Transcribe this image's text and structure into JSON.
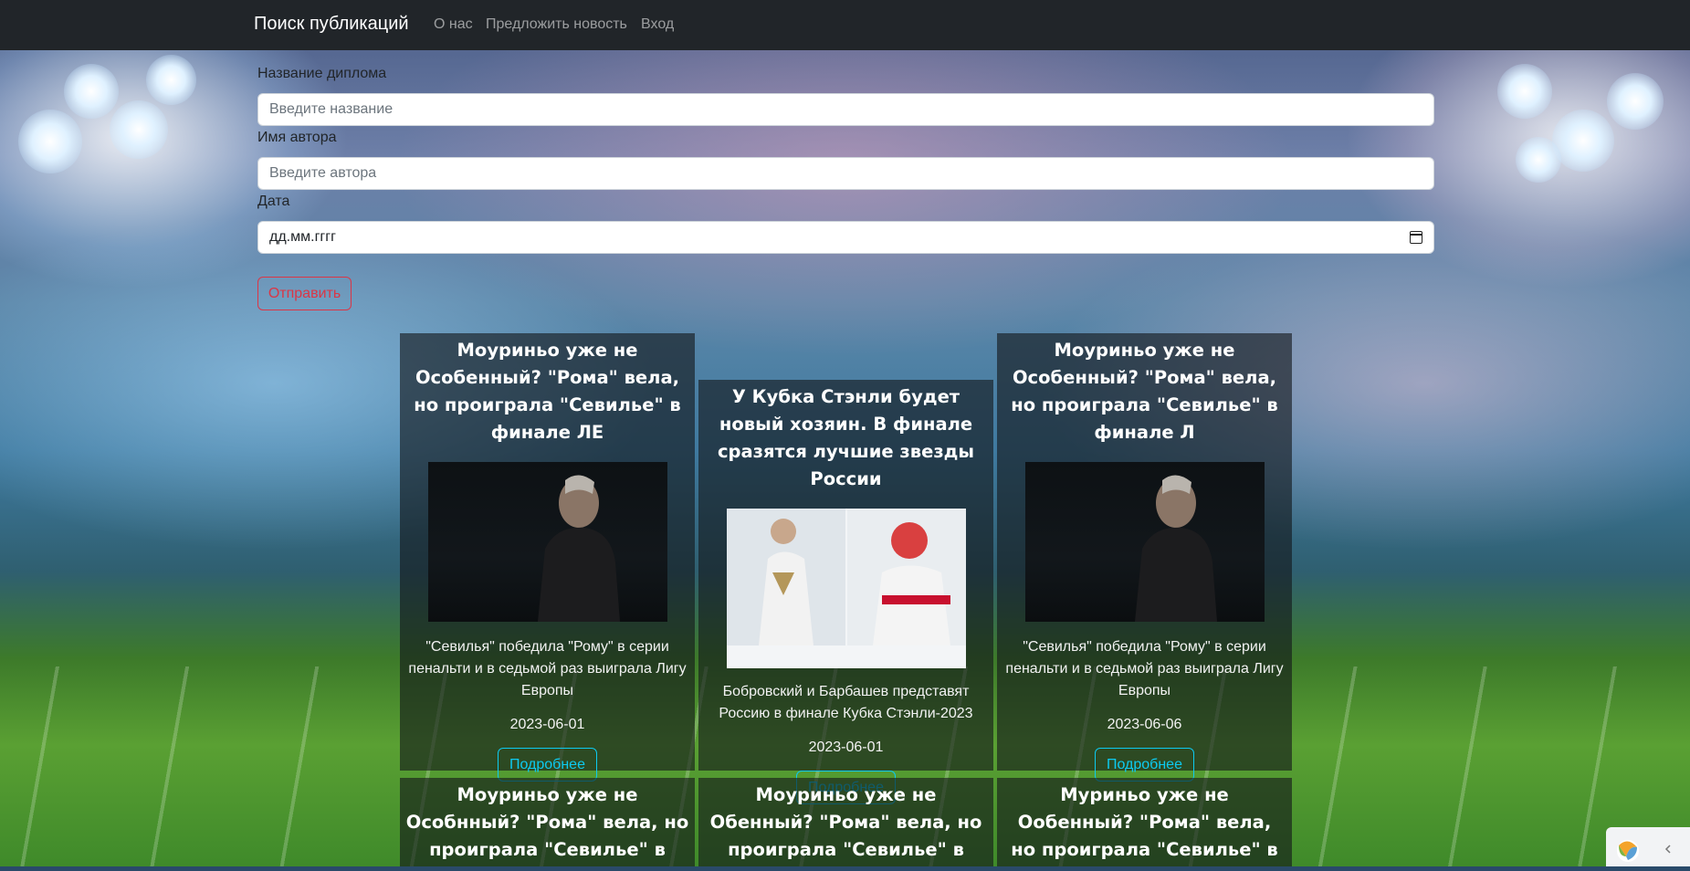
{
  "navbar": {
    "brand": "Поиск публикаций",
    "links": [
      "О нас",
      "Предложить новость",
      "Вход"
    ]
  },
  "form": {
    "title_label": "Название диплома",
    "title_placeholder": "Введите название",
    "author_label": "Имя автора",
    "author_placeholder": "Введите автора",
    "date_label": "Дата",
    "date_placeholder": "дд.мм.гггг",
    "submit_label": "Отправить"
  },
  "cards": [
    {
      "title": "Моуриньо уже не Особенный? \"Рома\" вела, но проиграла \"Севилье\" в финале ЛЕ",
      "text": "\"Севилья\" победила \"Рому\" в серии пенальти и в седьмой раз выиграла Лигу Европы",
      "date": "2023-06-01",
      "button": "Подробнее",
      "image": "mourinho-photo"
    },
    {
      "title": "У Кубка Стэнли будет новый хозяин. В финале сразятся лучшие звезды России",
      "text": "Бобровский и Барбашев представят Россию в финале Кубка Стэнли-2023",
      "date": "2023-06-01",
      "button": "Подробнее",
      "image": "hockey-photo"
    },
    {
      "title": "Моуриньо уже не Особенный? \"Рома\" вела, но проиграла \"Севилье\" в финале Л",
      "text": "\"Севилья\" победила \"Рому\" в серии пенальти и в седьмой раз выиграла Лигу Европы",
      "date": "2023-06-06",
      "button": "Подробнее",
      "image": "mourinho-photo"
    },
    {
      "title": "Моуриньо уже не Особнный? \"Рома\" вела, но проиграла \"Севилье\" в финале Л"
    },
    {
      "title": "Моуриньо уже не Обенный? \"Рома\" вела, но проиграла \"Севилье\" в финале Л"
    },
    {
      "title": "Муриньо уже не Ообенный? \"Рома\" вела, но проиграла \"Севилье\" в финале Л"
    }
  ],
  "colors": {
    "navbar": "#212529",
    "danger": "#dc3545",
    "info": "#0dcaf0"
  }
}
